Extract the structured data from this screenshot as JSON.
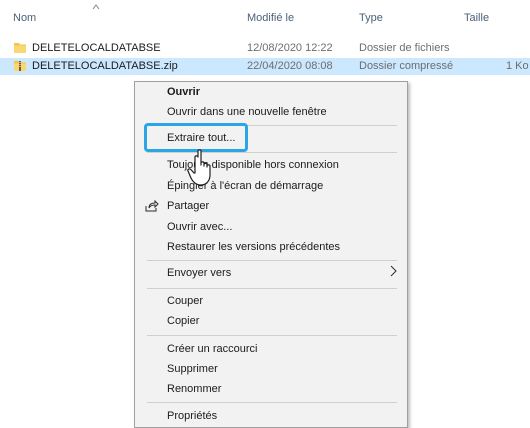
{
  "header": {
    "name": "Nom",
    "modified": "Modifié le",
    "type": "Type",
    "size": "Taille"
  },
  "files": [
    {
      "name": "DELETELOCALDATABSE",
      "modified": "12/08/2020 12:22",
      "type": "Dossier de fichiers",
      "size": "",
      "icon": "folder-icon"
    },
    {
      "name": "DELETELOCALDATABSE.zip",
      "modified": "22/04/2020 08:08",
      "type": "Dossier compressé",
      "size": "1 Ko",
      "icon": "zip-folder-icon"
    }
  ],
  "menu": {
    "open": "Ouvrir",
    "open_new_window": "Ouvrir dans une nouvelle fenêtre",
    "extract_all": "Extraire tout...",
    "offline": "Toujours disponible hors connexion",
    "pin_start": "Épingler à l'écran de démarrage",
    "share": "Partager",
    "open_with": "Ouvrir avec...",
    "restore": "Restaurer les versions précédentes",
    "send_to": "Envoyer vers",
    "cut": "Couper",
    "copy": "Copier",
    "shortcut": "Créer un raccourci",
    "delete": "Supprimer",
    "rename": "Renommer",
    "properties": "Propriétés"
  },
  "colors": {
    "selection": "#cce8ff",
    "highlight_border": "#2aa6e6",
    "folder": "#f3c447"
  }
}
